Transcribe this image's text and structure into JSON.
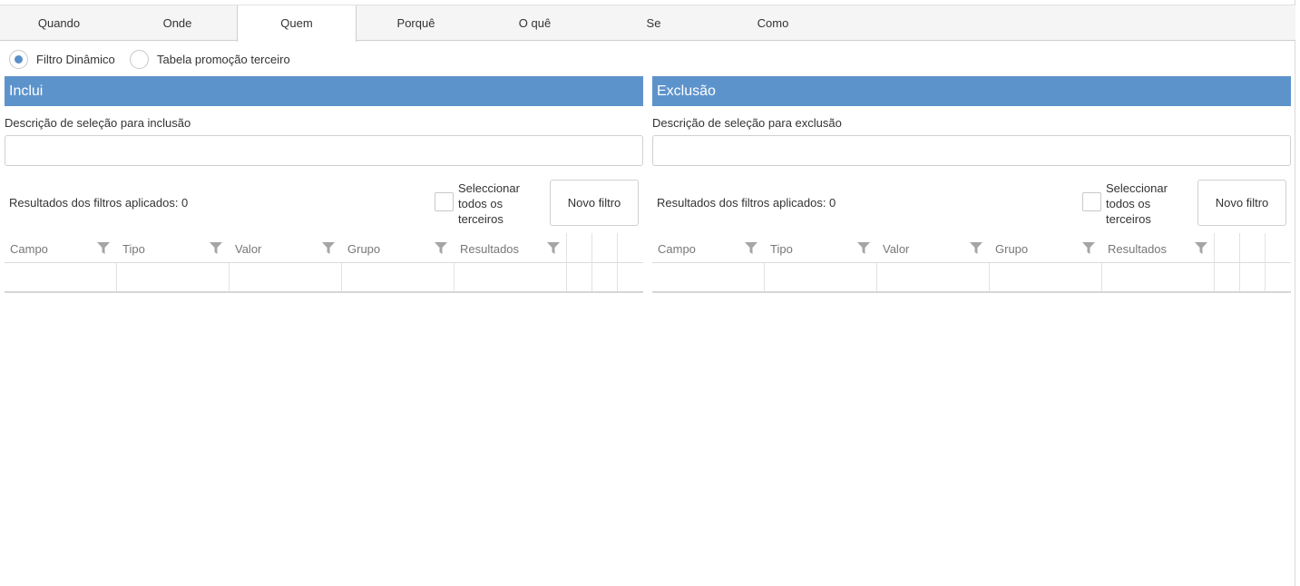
{
  "tabs": [
    {
      "label": "Quando",
      "active": false
    },
    {
      "label": "Onde",
      "active": false
    },
    {
      "label": "Quem",
      "active": true
    },
    {
      "label": "Porquê",
      "active": false
    },
    {
      "label": "O quê",
      "active": false
    },
    {
      "label": "Se",
      "active": false
    },
    {
      "label": "Como",
      "active": false
    }
  ],
  "mode": {
    "options": [
      {
        "label": "Filtro Dinâmico",
        "selected": true
      },
      {
        "label": "Tabela promoção terceiro",
        "selected": false
      }
    ]
  },
  "inclui": {
    "title": "Inclui",
    "description_label": "Descrição de seleção para inclusão",
    "description_value": "",
    "results_label": "Resultados dos filtros aplicados: 0",
    "select_all_label": "Seleccionar todos os terceiros",
    "select_all_checked": false,
    "new_filter_label": "Novo filtro",
    "columns": [
      "Campo",
      "Tipo",
      "Valor",
      "Grupo",
      "Resultados"
    ]
  },
  "exclusao": {
    "title": "Exclusão",
    "description_label": "Descrição de seleção para exclusão",
    "description_value": "",
    "results_label": "Resultados dos filtros aplicados: 0",
    "select_all_label": "Seleccionar todos os terceiros",
    "select_all_checked": false,
    "new_filter_label": "Novo filtro",
    "columns": [
      "Campo",
      "Tipo",
      "Valor",
      "Grupo",
      "Resultados"
    ]
  },
  "colors": {
    "accent": "#5d93cb",
    "radio_dot": "#5b8fc9",
    "tab_bar": "#f5f5f5",
    "border": "#d0d0d0"
  }
}
